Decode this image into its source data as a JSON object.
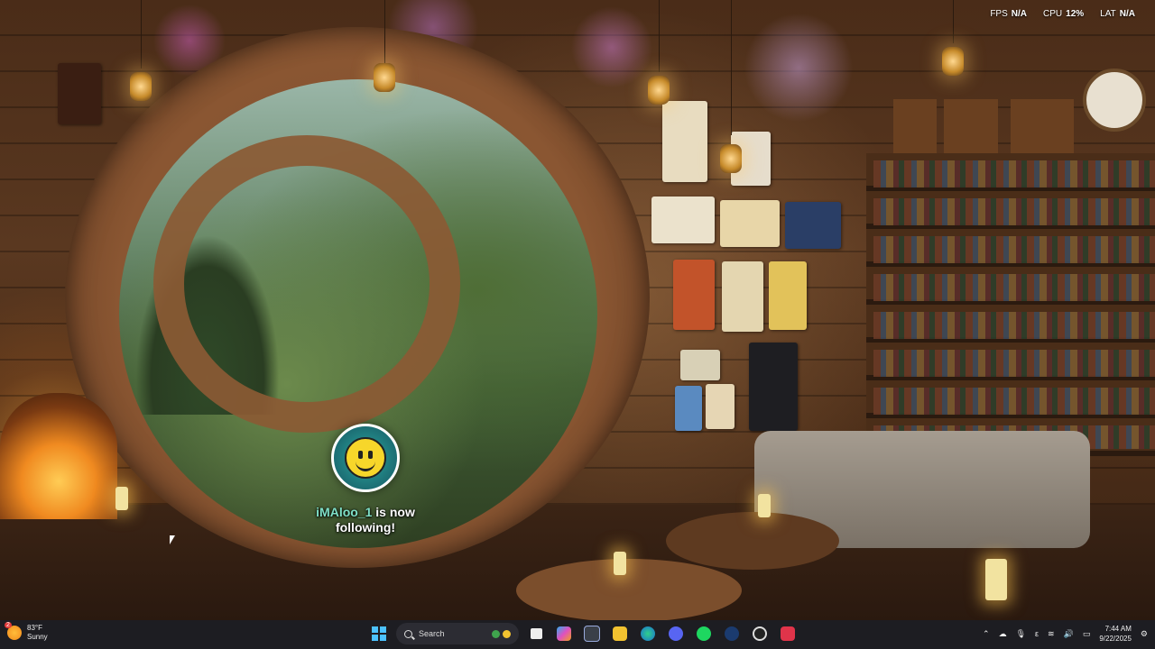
{
  "overlay": {
    "fps_label": "FPS",
    "fps_value": "N/A",
    "cpu_label": "CPU",
    "cpu_value": "12%",
    "lat_label": "LAT",
    "lat_value": "N/A"
  },
  "alert": {
    "username": "iMAloo_1",
    "line1_rest": " is now",
    "line2": "following!"
  },
  "taskbar": {
    "weather_temp": "83°F",
    "weather_cond": "Sunny",
    "weather_badge": "2",
    "search_placeholder": "Search",
    "time": "7:44 AM",
    "date": "9/22/2025",
    "apps": [
      "widgets-icon",
      "task-view-icon",
      "copilot-icon",
      "store-icon",
      "file-explorer-icon",
      "edge-icon",
      "discord-icon",
      "spotify-icon",
      "steam-icon",
      "obs-icon",
      "app-red-icon"
    ]
  },
  "colors": {
    "taskbar_bg": "#1d1d22",
    "username_color": "#7fe0c8",
    "accent": "#4cc2ff"
  }
}
